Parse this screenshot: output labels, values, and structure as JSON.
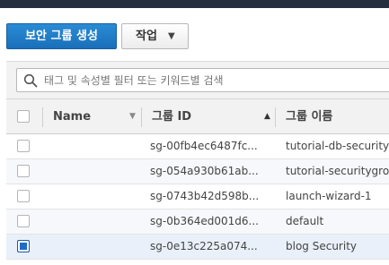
{
  "toolbar": {
    "create_label": "보안 그룹 생성",
    "actions_label": "작업",
    "actions_caret": "▼"
  },
  "search": {
    "placeholder": "태그 및 속성별 필터 또는 키워드별 검색"
  },
  "table": {
    "columns": {
      "name": "Name",
      "group_id": "그룹 ID",
      "group_name": "그룹 이름"
    },
    "sort": {
      "name_indicator": "▼",
      "group_id_indicator": "▲"
    },
    "rows": [
      {
        "name": "",
        "group_id": "sg-00fb4ec6487fc...",
        "group_name": "tutorial-db-security",
        "selected": false
      },
      {
        "name": "",
        "group_id": "sg-054a930b61ab...",
        "group_name": "tutorial-securitygro",
        "selected": false
      },
      {
        "name": "",
        "group_id": "sg-0743b42d598b...",
        "group_name": "launch-wizard-1",
        "selected": false
      },
      {
        "name": "",
        "group_id": "sg-0b364ed001d6...",
        "group_name": "default",
        "selected": false
      },
      {
        "name": "",
        "group_id": "sg-0e13c225a074...",
        "group_name": "blog Security",
        "selected": true
      }
    ]
  },
  "colors": {
    "topbar": "#232f3e",
    "primary": "#1a73c0",
    "selected_row": "#e9f0f9",
    "checkbox_checked": "#1e6cc8"
  }
}
